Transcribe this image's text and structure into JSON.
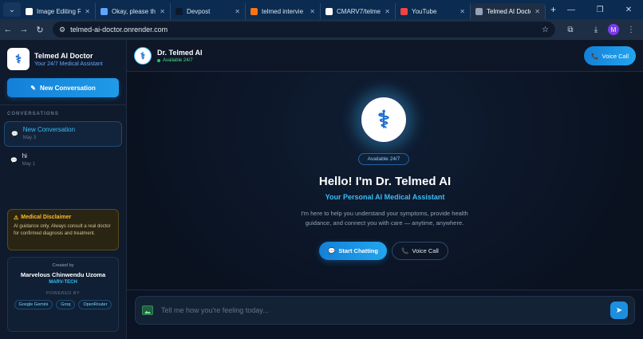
{
  "browser": {
    "tabs": [
      {
        "title": "Image Editing R",
        "icon": "doc-icon",
        "color": "#ffffff"
      },
      {
        "title": "Okay, please thi",
        "icon": "gemini-icon",
        "color": "#60a5fa"
      },
      {
        "title": "Devpost",
        "icon": "devpost-icon",
        "color": "#0b1a2e"
      },
      {
        "title": "telmed intervie",
        "icon": "image-icon",
        "color": "#f97316"
      },
      {
        "title": "CMARV7/telme",
        "icon": "github-icon",
        "color": "#ffffff"
      },
      {
        "title": "YouTube",
        "icon": "youtube-icon",
        "color": "#ef4444"
      },
      {
        "title": "Telmed AI Doctor",
        "icon": "globe-icon",
        "color": "#94a3b8"
      }
    ],
    "url": "telmed-ai-doctor.onrender.com",
    "profile_initial": "M"
  },
  "sidebar": {
    "brand_title": "Telmed AI Doctor",
    "brand_subtitle": "Your 24/7 Medical Assistant",
    "new_conversation_label": "New Conversation",
    "conversations_heading": "CONVERSATIONS",
    "conversations": [
      {
        "title": "New Conversation",
        "date": "May 3"
      },
      {
        "title": "hi",
        "date": "May 1"
      }
    ],
    "disclaimer": {
      "title": "Medical Disclaimer",
      "body": "AI guidance only. Always consult a real doctor for confirmed diagnosis and treatment."
    },
    "credit": {
      "created_by": "Created by",
      "name": "Marvelous Chinwendu Uzoma",
      "org": "MARV-TECH",
      "powered_by": "POWERED BY",
      "technologies": [
        "Google Gemini",
        "Groq",
        "OpenRouter"
      ]
    }
  },
  "chat_header": {
    "doctor_name": "Dr. Telmed AI",
    "status": "Available 24/7",
    "voice_call_label": "Voice Call"
  },
  "hero": {
    "badge": "Available 24/7",
    "greeting": "Hello! I'm Dr. Telmed AI",
    "subtitle": "Your Personal AI Medical Assistant",
    "description": "I'm here to help you understand your symptoms, provide health guidance, and connect you with care — anytime, anywhere.",
    "start_chatting_label": "Start Chatting",
    "voice_call_label": "Voice Call"
  },
  "composer": {
    "placeholder": "Tell me how you're feeling today..."
  },
  "colors": {
    "accent": "#1e9be8",
    "status_green": "#22c55e",
    "warning": "#fbbf24"
  }
}
